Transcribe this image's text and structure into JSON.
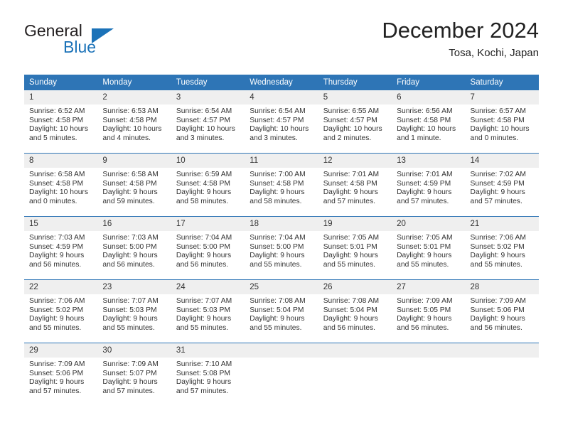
{
  "brand": {
    "name_top": "General",
    "name_bottom": "Blue",
    "accent_color": "#1b72b8"
  },
  "header": {
    "title": "December 2024",
    "subtitle": "Tosa, Kochi, Japan"
  },
  "theme": {
    "header_bg": "#2e75b6",
    "daynum_bg": "#efefef",
    "text": "#333333"
  },
  "weekday_headers": [
    "Sunday",
    "Monday",
    "Tuesday",
    "Wednesday",
    "Thursday",
    "Friday",
    "Saturday"
  ],
  "weeks": [
    [
      {
        "day": "1",
        "sunrise": "Sunrise: 6:52 AM",
        "sunset": "Sunset: 4:58 PM",
        "daylight": "Daylight: 10 hours and 5 minutes."
      },
      {
        "day": "2",
        "sunrise": "Sunrise: 6:53 AM",
        "sunset": "Sunset: 4:58 PM",
        "daylight": "Daylight: 10 hours and 4 minutes."
      },
      {
        "day": "3",
        "sunrise": "Sunrise: 6:54 AM",
        "sunset": "Sunset: 4:57 PM",
        "daylight": "Daylight: 10 hours and 3 minutes."
      },
      {
        "day": "4",
        "sunrise": "Sunrise: 6:54 AM",
        "sunset": "Sunset: 4:57 PM",
        "daylight": "Daylight: 10 hours and 3 minutes."
      },
      {
        "day": "5",
        "sunrise": "Sunrise: 6:55 AM",
        "sunset": "Sunset: 4:57 PM",
        "daylight": "Daylight: 10 hours and 2 minutes."
      },
      {
        "day": "6",
        "sunrise": "Sunrise: 6:56 AM",
        "sunset": "Sunset: 4:58 PM",
        "daylight": "Daylight: 10 hours and 1 minute."
      },
      {
        "day": "7",
        "sunrise": "Sunrise: 6:57 AM",
        "sunset": "Sunset: 4:58 PM",
        "daylight": "Daylight: 10 hours and 0 minutes."
      }
    ],
    [
      {
        "day": "8",
        "sunrise": "Sunrise: 6:58 AM",
        "sunset": "Sunset: 4:58 PM",
        "daylight": "Daylight: 10 hours and 0 minutes."
      },
      {
        "day": "9",
        "sunrise": "Sunrise: 6:58 AM",
        "sunset": "Sunset: 4:58 PM",
        "daylight": "Daylight: 9 hours and 59 minutes."
      },
      {
        "day": "10",
        "sunrise": "Sunrise: 6:59 AM",
        "sunset": "Sunset: 4:58 PM",
        "daylight": "Daylight: 9 hours and 58 minutes."
      },
      {
        "day": "11",
        "sunrise": "Sunrise: 7:00 AM",
        "sunset": "Sunset: 4:58 PM",
        "daylight": "Daylight: 9 hours and 58 minutes."
      },
      {
        "day": "12",
        "sunrise": "Sunrise: 7:01 AM",
        "sunset": "Sunset: 4:58 PM",
        "daylight": "Daylight: 9 hours and 57 minutes."
      },
      {
        "day": "13",
        "sunrise": "Sunrise: 7:01 AM",
        "sunset": "Sunset: 4:59 PM",
        "daylight": "Daylight: 9 hours and 57 minutes."
      },
      {
        "day": "14",
        "sunrise": "Sunrise: 7:02 AM",
        "sunset": "Sunset: 4:59 PM",
        "daylight": "Daylight: 9 hours and 57 minutes."
      }
    ],
    [
      {
        "day": "15",
        "sunrise": "Sunrise: 7:03 AM",
        "sunset": "Sunset: 4:59 PM",
        "daylight": "Daylight: 9 hours and 56 minutes."
      },
      {
        "day": "16",
        "sunrise": "Sunrise: 7:03 AM",
        "sunset": "Sunset: 5:00 PM",
        "daylight": "Daylight: 9 hours and 56 minutes."
      },
      {
        "day": "17",
        "sunrise": "Sunrise: 7:04 AM",
        "sunset": "Sunset: 5:00 PM",
        "daylight": "Daylight: 9 hours and 56 minutes."
      },
      {
        "day": "18",
        "sunrise": "Sunrise: 7:04 AM",
        "sunset": "Sunset: 5:00 PM",
        "daylight": "Daylight: 9 hours and 55 minutes."
      },
      {
        "day": "19",
        "sunrise": "Sunrise: 7:05 AM",
        "sunset": "Sunset: 5:01 PM",
        "daylight": "Daylight: 9 hours and 55 minutes."
      },
      {
        "day": "20",
        "sunrise": "Sunrise: 7:05 AM",
        "sunset": "Sunset: 5:01 PM",
        "daylight": "Daylight: 9 hours and 55 minutes."
      },
      {
        "day": "21",
        "sunrise": "Sunrise: 7:06 AM",
        "sunset": "Sunset: 5:02 PM",
        "daylight": "Daylight: 9 hours and 55 minutes."
      }
    ],
    [
      {
        "day": "22",
        "sunrise": "Sunrise: 7:06 AM",
        "sunset": "Sunset: 5:02 PM",
        "daylight": "Daylight: 9 hours and 55 minutes."
      },
      {
        "day": "23",
        "sunrise": "Sunrise: 7:07 AM",
        "sunset": "Sunset: 5:03 PM",
        "daylight": "Daylight: 9 hours and 55 minutes."
      },
      {
        "day": "24",
        "sunrise": "Sunrise: 7:07 AM",
        "sunset": "Sunset: 5:03 PM",
        "daylight": "Daylight: 9 hours and 55 minutes."
      },
      {
        "day": "25",
        "sunrise": "Sunrise: 7:08 AM",
        "sunset": "Sunset: 5:04 PM",
        "daylight": "Daylight: 9 hours and 55 minutes."
      },
      {
        "day": "26",
        "sunrise": "Sunrise: 7:08 AM",
        "sunset": "Sunset: 5:04 PM",
        "daylight": "Daylight: 9 hours and 56 minutes."
      },
      {
        "day": "27",
        "sunrise": "Sunrise: 7:09 AM",
        "sunset": "Sunset: 5:05 PM",
        "daylight": "Daylight: 9 hours and 56 minutes."
      },
      {
        "day": "28",
        "sunrise": "Sunrise: 7:09 AM",
        "sunset": "Sunset: 5:06 PM",
        "daylight": "Daylight: 9 hours and 56 minutes."
      }
    ],
    [
      {
        "day": "29",
        "sunrise": "Sunrise: 7:09 AM",
        "sunset": "Sunset: 5:06 PM",
        "daylight": "Daylight: 9 hours and 57 minutes."
      },
      {
        "day": "30",
        "sunrise": "Sunrise: 7:09 AM",
        "sunset": "Sunset: 5:07 PM",
        "daylight": "Daylight: 9 hours and 57 minutes."
      },
      {
        "day": "31",
        "sunrise": "Sunrise: 7:10 AM",
        "sunset": "Sunset: 5:08 PM",
        "daylight": "Daylight: 9 hours and 57 minutes."
      },
      {
        "day": "",
        "sunrise": "",
        "sunset": "",
        "daylight": ""
      },
      {
        "day": "",
        "sunrise": "",
        "sunset": "",
        "daylight": ""
      },
      {
        "day": "",
        "sunrise": "",
        "sunset": "",
        "daylight": ""
      },
      {
        "day": "",
        "sunrise": "",
        "sunset": "",
        "daylight": ""
      }
    ]
  ]
}
